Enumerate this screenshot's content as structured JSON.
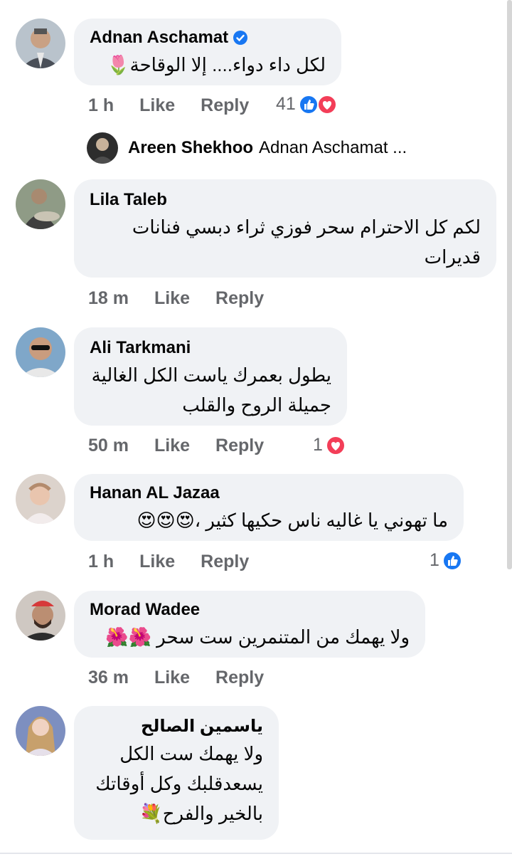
{
  "comments": [
    {
      "name": "Adnan Aschamat",
      "verified": true,
      "text": "لكل داء دواء.... إلا الوقاحة🌷",
      "time": "1 h",
      "like": "Like",
      "reply": "Reply",
      "reaction_count": "41",
      "reactions": [
        "like-icon",
        "love-icon"
      ]
    },
    {
      "name": "Lila Taleb",
      "text": "لكم كل الاحترام سحر فوزي ثراء دبسي فنانات قديرات",
      "time": "18 m",
      "like": "Like",
      "reply": "Reply"
    },
    {
      "name": "Ali Tarkmani",
      "text": "يطول بعمرك ياست الكل الغالية جميلة الروح والقلب",
      "time": "50 m",
      "like": "Like",
      "reply": "Reply",
      "reaction_count": "1",
      "reactions": [
        "love-icon"
      ]
    },
    {
      "name": "Hanan AL Jazaa",
      "text": "ما تهوني يا غاليه ناس حكيها كثير ،😍😍😍",
      "time": "1 h",
      "like": "Like",
      "reply": "Reply",
      "reaction_count": "1",
      "reactions": [
        "like-icon"
      ]
    },
    {
      "name": "Morad Wadee",
      "text": "ولا يهمك من المتنمرين ست سحر 🌺🌺",
      "time": "36 m",
      "like": "Like",
      "reply": "Reply"
    },
    {
      "name": "ياسمين الصالح",
      "text": "ولا يهمك ست الكل يسعدقلبك وكل أوقاتك بالخير والفرح💐"
    }
  ],
  "reply_preview": {
    "name": "Areen Shekhoo",
    "text": "Adnan Aschamat ..."
  },
  "colors": {
    "bubble": "#f0f2f5",
    "meta": "#65676b",
    "like_blue": "#1877f2",
    "love_red": "#f33e58"
  }
}
